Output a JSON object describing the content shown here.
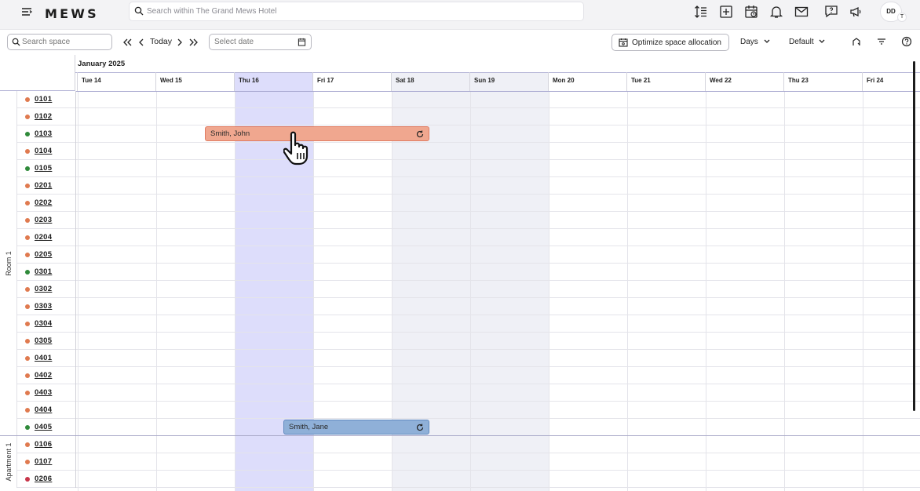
{
  "app": {
    "logo": "MEWS",
    "user_initials": "DD",
    "user_sub": "T"
  },
  "search": {
    "placeholder": "Search within The Grand Mews Hotel"
  },
  "toolbar": {
    "space_search_placeholder": "Search space",
    "today_label": "Today",
    "date_placeholder": "Select date",
    "optimize_label": "Optimize space allocation",
    "view_label": "Days",
    "layout_label": "Default"
  },
  "calendar": {
    "month": "January 2025",
    "days": [
      "Tue 14",
      "Wed 15",
      "Thu 16",
      "Fri 17",
      "Sat 18",
      "Sun 19",
      "Mon 20",
      "Tue 21",
      "Wed 22",
      "Thu 23",
      "Fri 24"
    ],
    "today_index": 2,
    "weekend_indices": [
      4,
      5
    ],
    "groups": [
      {
        "label": "Room 1",
        "rooms": [
          {
            "name": "0101",
            "status": "orange"
          },
          {
            "name": "0102",
            "status": "orange"
          },
          {
            "name": "0103",
            "status": "green"
          },
          {
            "name": "0104",
            "status": "orange"
          },
          {
            "name": "0105",
            "status": "green"
          },
          {
            "name": "0201",
            "status": "orange"
          },
          {
            "name": "0202",
            "status": "orange"
          },
          {
            "name": "0203",
            "status": "orange"
          },
          {
            "name": "0204",
            "status": "orange"
          },
          {
            "name": "0205",
            "status": "orange"
          },
          {
            "name": "0301",
            "status": "green"
          },
          {
            "name": "0302",
            "status": "orange"
          },
          {
            "name": "0303",
            "status": "orange"
          },
          {
            "name": "0304",
            "status": "orange"
          },
          {
            "name": "0305",
            "status": "orange"
          },
          {
            "name": "0401",
            "status": "orange"
          },
          {
            "name": "0402",
            "status": "orange"
          },
          {
            "name": "0403",
            "status": "orange"
          },
          {
            "name": "0404",
            "status": "orange"
          },
          {
            "name": "0405",
            "status": "green"
          }
        ]
      },
      {
        "label": "Apartment 1",
        "rooms": [
          {
            "name": "0106",
            "status": "orange"
          },
          {
            "name": "0107",
            "status": "orange"
          },
          {
            "name": "0206",
            "status": "red"
          }
        ]
      }
    ],
    "bookings": [
      {
        "guest": "Smith, John",
        "room": "0103",
        "start_day": 1.63,
        "end_day": 4.49,
        "color": "#f0a78f",
        "border": "#e07c62",
        "icon": "refresh-icon"
      },
      {
        "guest": "Smith, Jane",
        "room": "0405",
        "start_day": 2.63,
        "end_day": 4.49,
        "color": "#8fb0d8",
        "border": "#5f89c0",
        "icon": "refresh-icon"
      }
    ]
  },
  "colors": {
    "orange": "#e07a4f",
    "green": "#2f8a3a",
    "red": "#c8364a",
    "accent": "#6b6bf0"
  }
}
